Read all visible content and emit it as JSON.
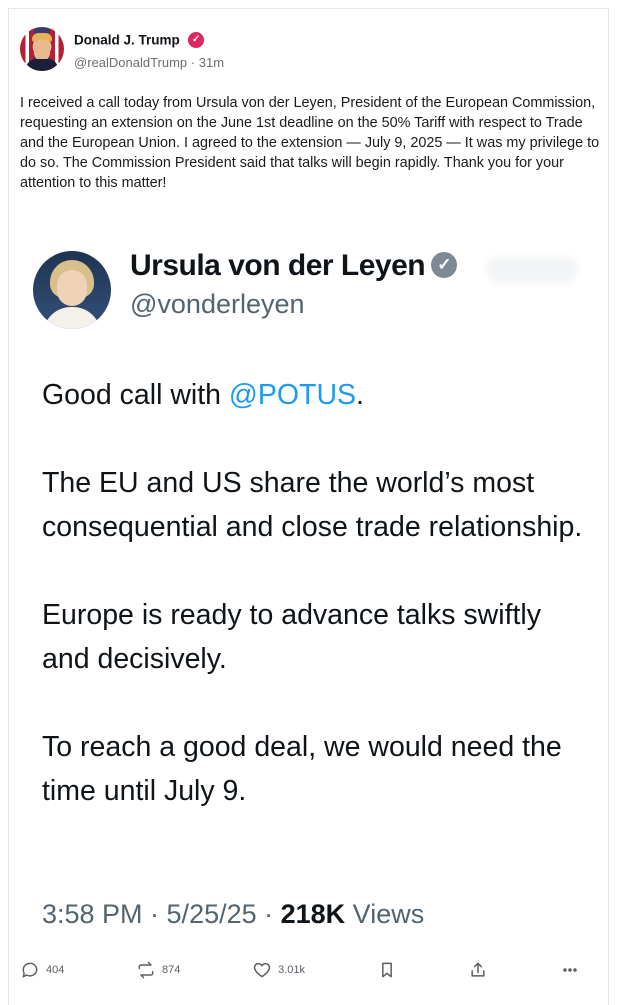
{
  "post": {
    "author_name": "Donald J. Trump",
    "handle": "@realDonaldTrump",
    "time": "31m",
    "text": "I received a call today from Ursula von der Leyen, President of the European Commission, requesting an extension on the June 1st deadline on the 50% Tariff with respect to Trade and the European Union. I agreed to the extension — July 9, 2025 — It was my privilege to do so. The Commission President said that talks will begin rapidly. Thank you for your attention to this matter!"
  },
  "embed": {
    "name": "Ursula von der Leyen",
    "handle": "@vonderleyen",
    "line1_prefix": "Good call with ",
    "mention": "@POTUS",
    "line1_suffix": ".",
    "para2": "The EU and US share the world’s most consequential and close trade relationship.",
    "para3": "Europe is ready to advance talks swiftly and decisively.",
    "para4": "To reach a good deal, we would need the time until July 9.",
    "timestamp": "3:58 PM · 5/25/25 · ",
    "views_count": "218K",
    "views_label": " Views"
  },
  "actions": {
    "replies": "404",
    "reposts": "874",
    "likes": "3.01k"
  },
  "colors": {
    "badge": "#e0245e",
    "mention": "#1d9bf0",
    "verified_grey": "#7d8a96"
  },
  "icons": [
    "verified-badge-icon",
    "reply-icon",
    "repost-icon",
    "like-icon",
    "bookmark-icon",
    "share-icon",
    "more-icon"
  ]
}
